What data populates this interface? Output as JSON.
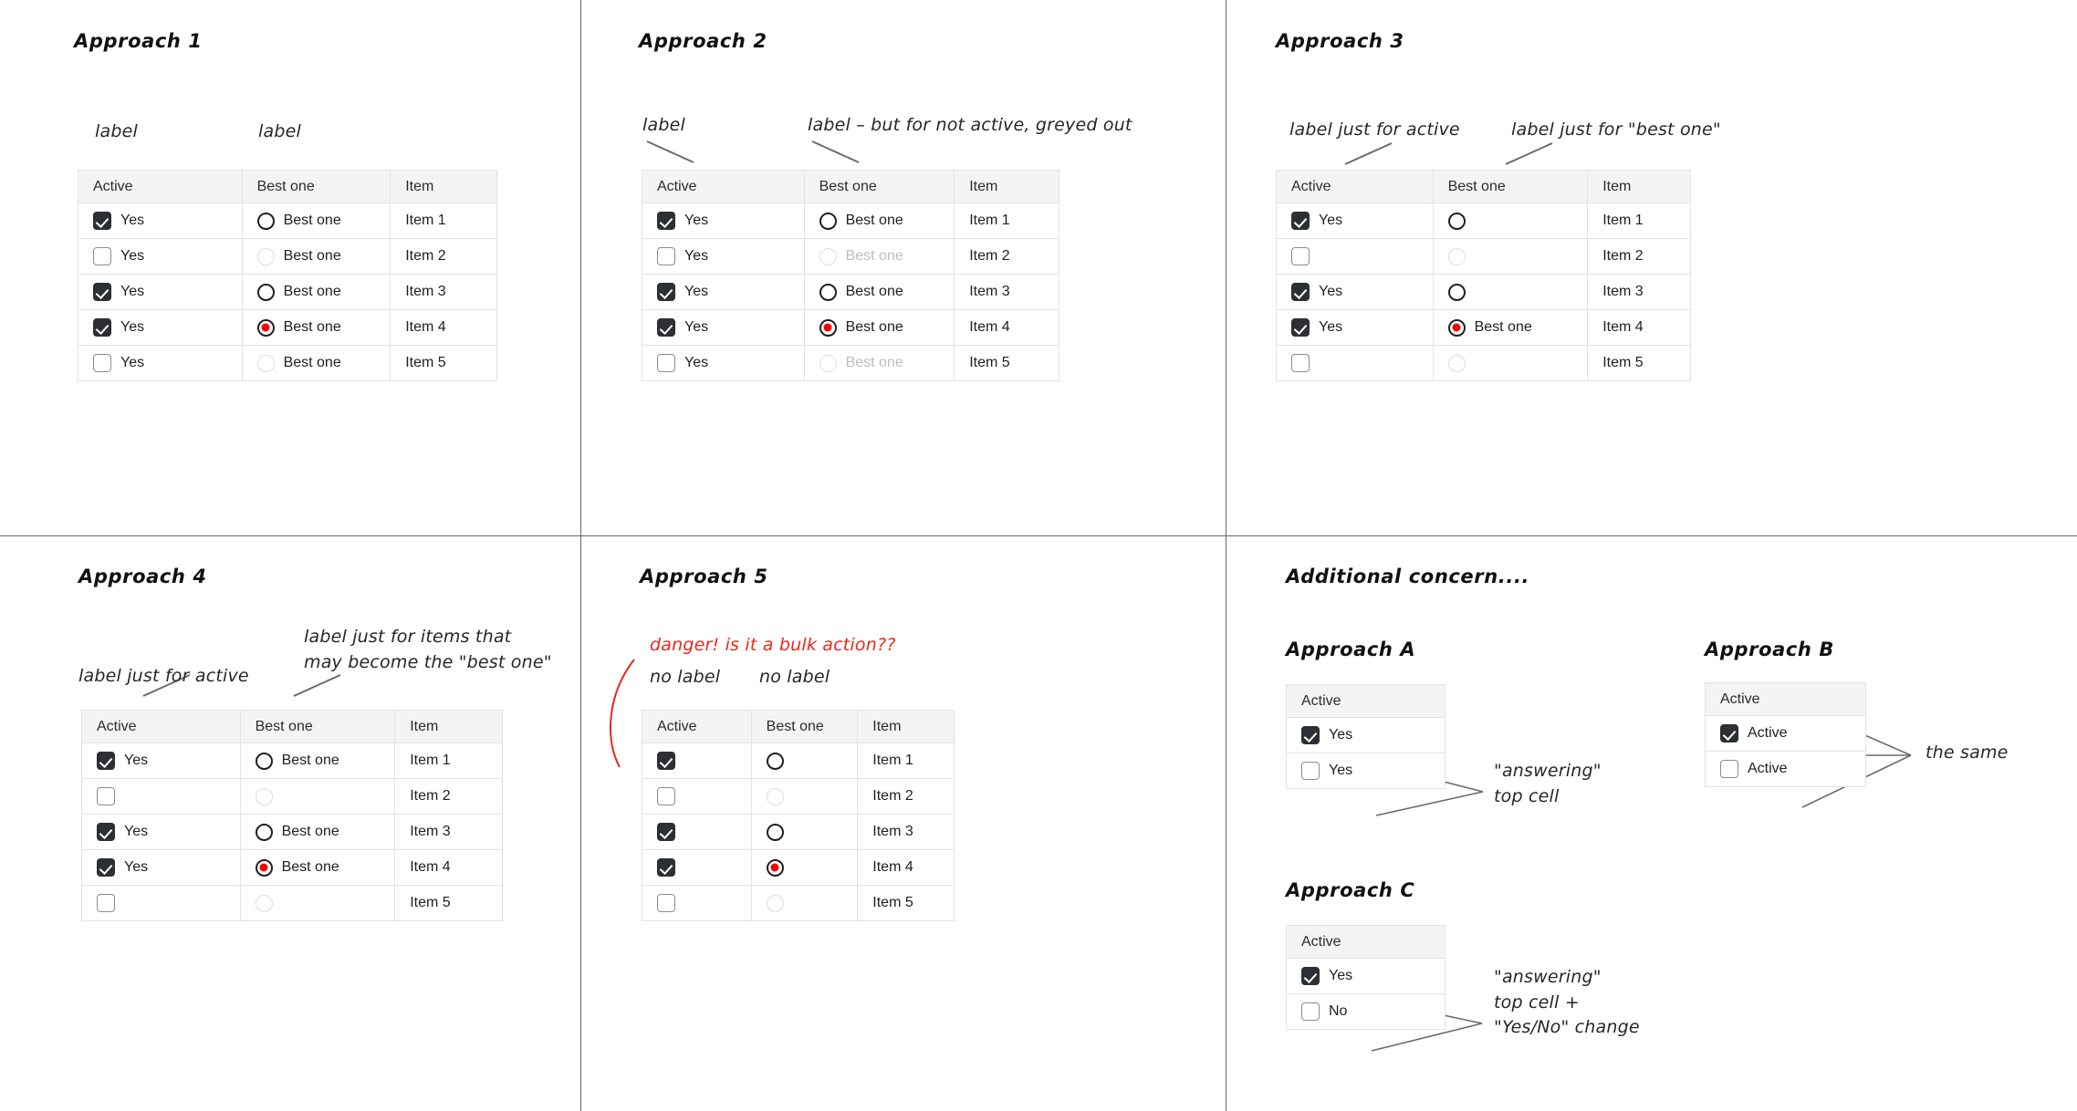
{
  "panels": {
    "a1": {
      "title": "Approach 1",
      "annotations": [
        {
          "text": "label"
        },
        {
          "text": "label"
        }
      ],
      "table": {
        "headers": [
          "Active",
          "Best one",
          "Item"
        ],
        "rows": [
          {
            "checked": true,
            "check_label": "Yes",
            "radio": "empty",
            "radio_label": "Best one",
            "radio_label_dim": false,
            "item": "Item 1"
          },
          {
            "checked": false,
            "check_label": "Yes",
            "radio": "dim",
            "radio_label": "Best one",
            "radio_label_dim": false,
            "item": "Item 2"
          },
          {
            "checked": true,
            "check_label": "Yes",
            "radio": "empty",
            "radio_label": "Best one",
            "radio_label_dim": false,
            "item": "Item 3"
          },
          {
            "checked": true,
            "check_label": "Yes",
            "radio": "selected",
            "radio_label": "Best one",
            "radio_label_dim": false,
            "item": "Item 4"
          },
          {
            "checked": false,
            "check_label": "Yes",
            "radio": "dim",
            "radio_label": "Best one",
            "radio_label_dim": false,
            "item": "Item 5"
          }
        ]
      }
    },
    "a2": {
      "title": "Approach 2",
      "annotations": [
        {
          "text": "label"
        },
        {
          "text": "label – but for not active, greyed out"
        }
      ],
      "table": {
        "headers": [
          "Active",
          "Best one",
          "Item"
        ],
        "rows": [
          {
            "checked": true,
            "check_label": "Yes",
            "radio": "empty",
            "radio_label": "Best one",
            "radio_label_dim": false,
            "item": "Item 1"
          },
          {
            "checked": false,
            "check_label": "Yes",
            "radio": "dim",
            "radio_label": "Best one",
            "radio_label_dim": true,
            "item": "Item 2"
          },
          {
            "checked": true,
            "check_label": "Yes",
            "radio": "empty",
            "radio_label": "Best one",
            "radio_label_dim": false,
            "item": "Item 3"
          },
          {
            "checked": true,
            "check_label": "Yes",
            "radio": "selected",
            "radio_label": "Best one",
            "radio_label_dim": false,
            "item": "Item 4"
          },
          {
            "checked": false,
            "check_label": "Yes",
            "radio": "dim",
            "radio_label": "Best one",
            "radio_label_dim": true,
            "item": "Item 5"
          }
        ]
      }
    },
    "a3": {
      "title": "Approach 3",
      "annotations": [
        {
          "text": "label just for active"
        },
        {
          "text": "label just for \"best one\""
        }
      ],
      "table": {
        "headers": [
          "Active",
          "Best one",
          "Item"
        ],
        "rows": [
          {
            "checked": true,
            "check_label": "Yes",
            "radio": "empty",
            "radio_label": "",
            "radio_label_dim": false,
            "item": "Item 1"
          },
          {
            "checked": false,
            "check_label": "",
            "radio": "dim",
            "radio_label": "",
            "radio_label_dim": false,
            "item": "Item 2"
          },
          {
            "checked": true,
            "check_label": "Yes",
            "radio": "empty",
            "radio_label": "",
            "radio_label_dim": false,
            "item": "Item 3"
          },
          {
            "checked": true,
            "check_label": "Yes",
            "radio": "selected",
            "radio_label": "Best one",
            "radio_label_dim": false,
            "item": "Item 4"
          },
          {
            "checked": false,
            "check_label": "",
            "radio": "dim",
            "radio_label": "",
            "radio_label_dim": false,
            "item": "Item 5"
          }
        ]
      }
    },
    "a4": {
      "title": "Approach 4",
      "annotations": [
        {
          "text": "label just for active"
        },
        {
          "text": "label just for items that\nmay become the \"best one\""
        }
      ],
      "table": {
        "headers": [
          "Active",
          "Best one",
          "Item"
        ],
        "rows": [
          {
            "checked": true,
            "check_label": "Yes",
            "radio": "empty",
            "radio_label": "Best one",
            "radio_label_dim": false,
            "item": "Item 1"
          },
          {
            "checked": false,
            "check_label": "",
            "radio": "dim",
            "radio_label": "",
            "radio_label_dim": false,
            "item": "Item 2"
          },
          {
            "checked": true,
            "check_label": "Yes",
            "radio": "empty",
            "radio_label": "Best one",
            "radio_label_dim": false,
            "item": "Item 3"
          },
          {
            "checked": true,
            "check_label": "Yes",
            "radio": "selected",
            "radio_label": "Best one",
            "radio_label_dim": false,
            "item": "Item 4"
          },
          {
            "checked": false,
            "check_label": "",
            "radio": "dim",
            "radio_label": "",
            "radio_label_dim": false,
            "item": "Item 5"
          }
        ]
      }
    },
    "a5": {
      "title": "Approach 5",
      "danger_note": "danger! is it a bulk action??",
      "annotations": [
        {
          "text": "no label"
        },
        {
          "text": "no label"
        }
      ],
      "table": {
        "headers": [
          "Active",
          "Best one",
          "Item"
        ],
        "rows": [
          {
            "checked": true,
            "check_label": "",
            "radio": "empty",
            "radio_label": "",
            "radio_label_dim": false,
            "item": "Item 1"
          },
          {
            "checked": false,
            "check_label": "",
            "radio": "dim",
            "radio_label": "",
            "radio_label_dim": false,
            "item": "Item 2"
          },
          {
            "checked": true,
            "check_label": "",
            "radio": "empty",
            "radio_label": "",
            "radio_label_dim": false,
            "item": "Item 3"
          },
          {
            "checked": true,
            "check_label": "",
            "radio": "selected",
            "radio_label": "",
            "radio_label_dim": false,
            "item": "Item 4"
          },
          {
            "checked": false,
            "check_label": "",
            "radio": "dim",
            "radio_label": "",
            "radio_label_dim": false,
            "item": "Item 5"
          }
        ]
      }
    },
    "concern": {
      "title": "Additional concern....",
      "approach_a": {
        "title": "Approach A",
        "header": "Active",
        "rows": [
          {
            "checked": true,
            "label": "Yes"
          },
          {
            "checked": false,
            "label": "Yes"
          }
        ],
        "note": "\"answering\"\ntop cell"
      },
      "approach_b": {
        "title": "Approach B",
        "header": "Active",
        "rows": [
          {
            "checked": true,
            "label": "Active"
          },
          {
            "checked": false,
            "label": "Active"
          }
        ],
        "note": "the same"
      },
      "approach_c": {
        "title": "Approach C",
        "header": "Active",
        "rows": [
          {
            "checked": true,
            "label": "Yes"
          },
          {
            "checked": false,
            "label": "No"
          }
        ],
        "note": "\"answering\"\ntop cell +\n\"Yes/No\" change"
      }
    }
  },
  "colors": {
    "checkbox_on": "#2c2f33",
    "radio_selected": "#f40000",
    "danger_text": "#e8291c",
    "table_header_bg": "#f4f4f4",
    "table_border": "#e3e3e3"
  }
}
